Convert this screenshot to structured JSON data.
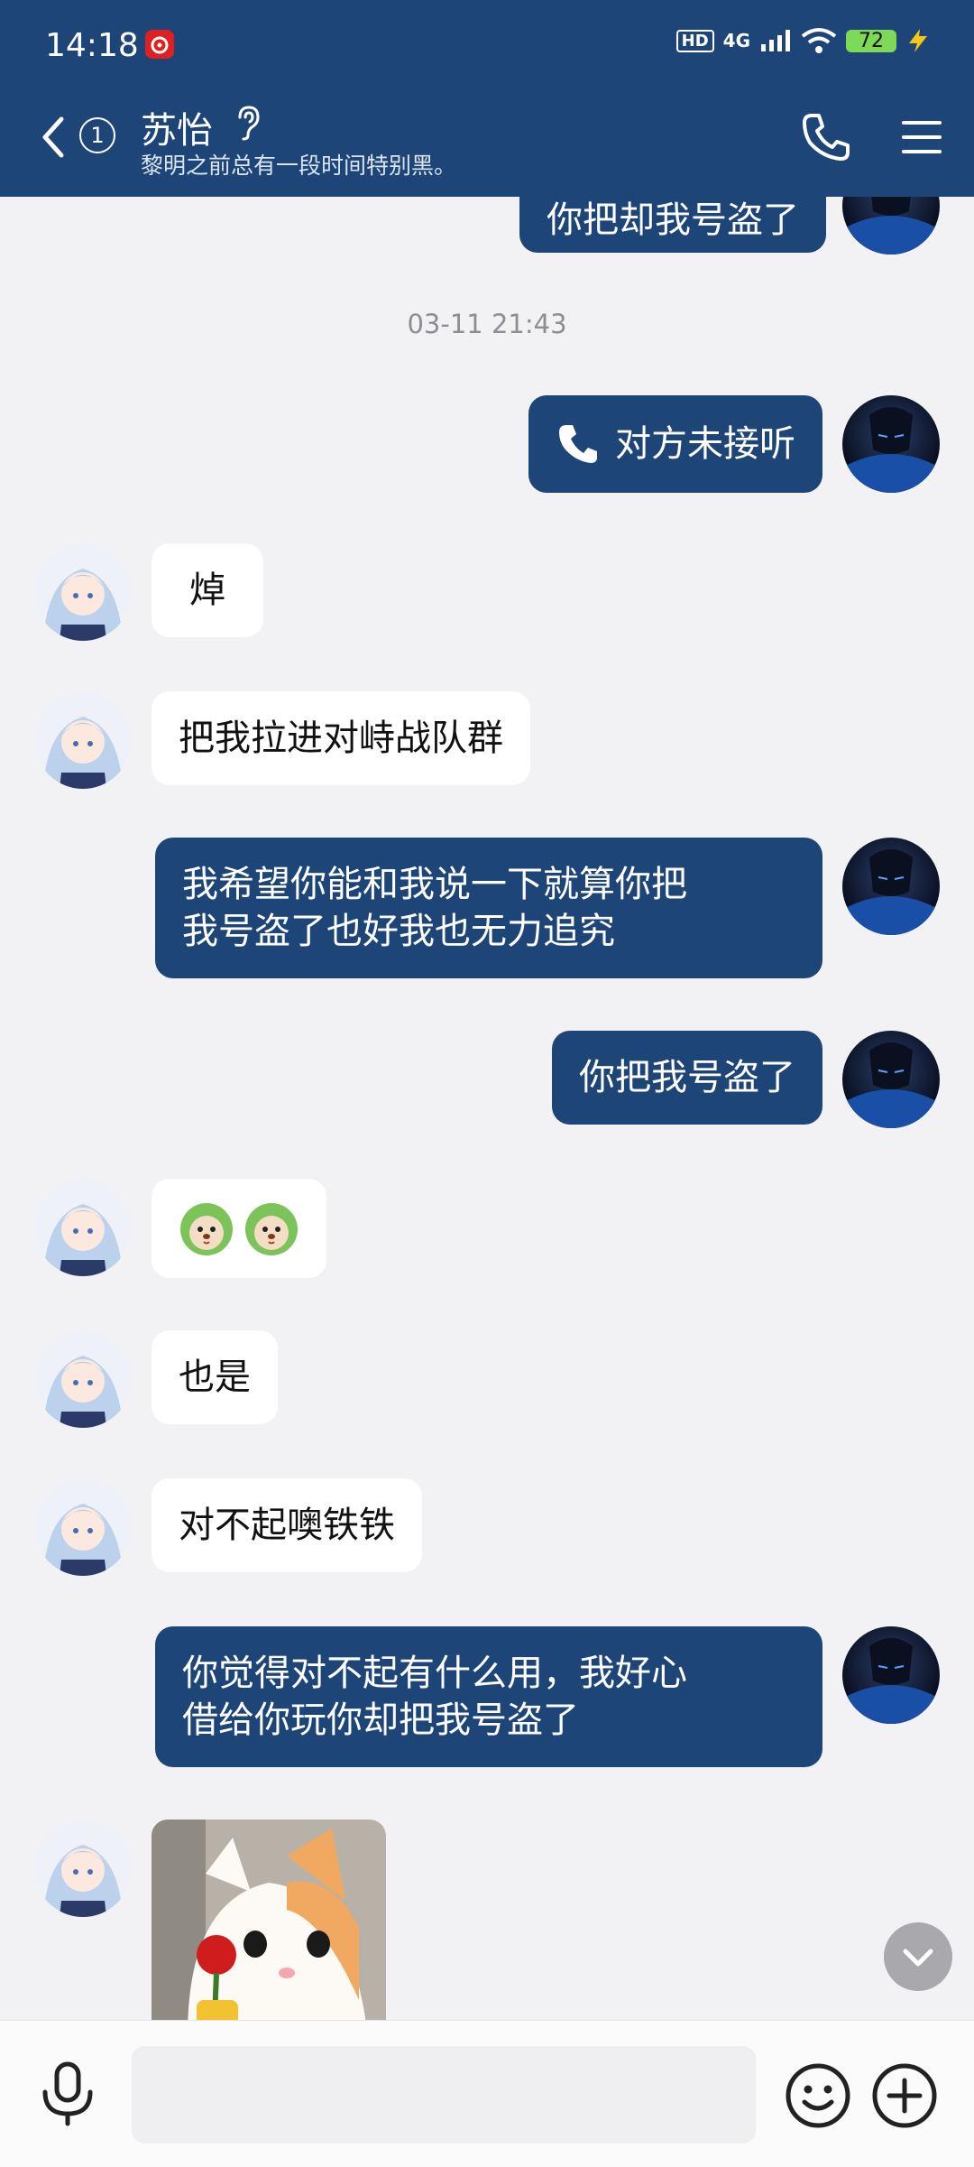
{
  "status_bar": {
    "time": "14:18",
    "hd": "HD",
    "network": "4G",
    "battery": "72"
  },
  "header": {
    "unread_count": "1",
    "contact_name": "苏怡",
    "signature": "黎明之前总有一段时间特别黑。"
  },
  "chat": {
    "partial_top_message": "你把却我号盗了",
    "timestamp": "03-11 21:43",
    "call_status": "对方未接听",
    "messages": [
      {
        "text": "焯"
      },
      {
        "text": "把我拉进对峙战队群"
      },
      {
        "line1": "我希望你能和我说一下就算你把",
        "line2": "我号盗了也好我也无力追究"
      },
      {
        "text": "你把我号盗了"
      },
      {
        "text": "也是"
      },
      {
        "text": "对不起噢铁铁"
      },
      {
        "line1": "你觉得对不起有什么用，我好心",
        "line2": "借给你玩你却把我号盗了"
      }
    ]
  },
  "input": {
    "placeholder": ""
  },
  "colors": {
    "header_bg": "#1e4578",
    "my_bubble": "#1e4578",
    "their_bubble": "#ffffff",
    "chat_bg": "#f2f2f4"
  }
}
